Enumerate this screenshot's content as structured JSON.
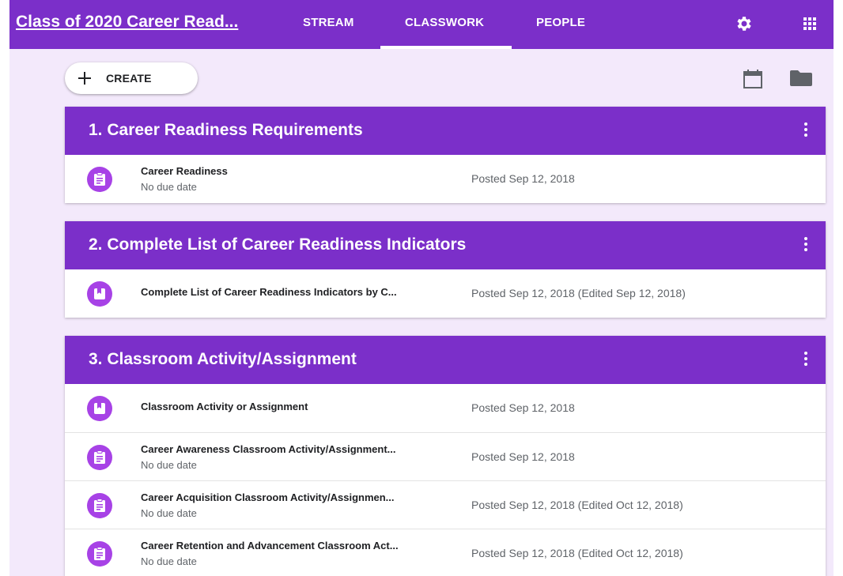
{
  "header": {
    "course_title": "Class of 2020 Career Read...",
    "tabs": [
      "STREAM",
      "CLASSWORK",
      "PEOPLE"
    ],
    "active_tab": "CLASSWORK",
    "icons": [
      "gear-icon",
      "apps-grid-icon"
    ]
  },
  "toolbar": {
    "create_label": "CREATE",
    "icons": [
      "plus-icon",
      "calendar-icon",
      "folder-icon"
    ]
  },
  "colors": {
    "accent": "#7b2fc9",
    "item_icon": "#a742e6",
    "background": "#f3e9fb"
  },
  "topics": [
    {
      "title": "1. Career Readiness Requirements",
      "items": [
        {
          "type": "assignment",
          "icon": "assignment-icon",
          "title": "Career Readiness",
          "due": "No due date",
          "posted": "Posted Sep 12, 2018"
        }
      ]
    },
    {
      "title": "2. Complete List of Career Readiness Indicators",
      "items": [
        {
          "type": "material",
          "icon": "material-icon",
          "title": "Complete List of Career Readiness Indicators by C...",
          "due": "",
          "posted": "Posted Sep 12, 2018 (Edited Sep 12, 2018)"
        }
      ]
    },
    {
      "title": "3. Classroom Activity/Assignment",
      "items": [
        {
          "type": "material",
          "icon": "material-icon",
          "title": "Classroom Activity or Assignment",
          "due": "",
          "posted": "Posted Sep 12, 2018"
        },
        {
          "type": "assignment",
          "icon": "assignment-icon",
          "title": "Career Awareness Classroom Activity/Assignment...",
          "due": "No due date",
          "posted": "Posted Sep 12, 2018"
        },
        {
          "type": "assignment",
          "icon": "assignment-icon",
          "title": "Career Acquisition Classroom Activity/Assignmen...",
          "due": "No due date",
          "posted": "Posted Sep 12, 2018 (Edited Oct 12, 2018)"
        },
        {
          "type": "assignment",
          "icon": "assignment-icon",
          "title": "Career Retention and Advancement Classroom Act...",
          "due": "No due date",
          "posted": "Posted Sep 12, 2018 (Edited Oct 12, 2018)"
        }
      ]
    }
  ]
}
